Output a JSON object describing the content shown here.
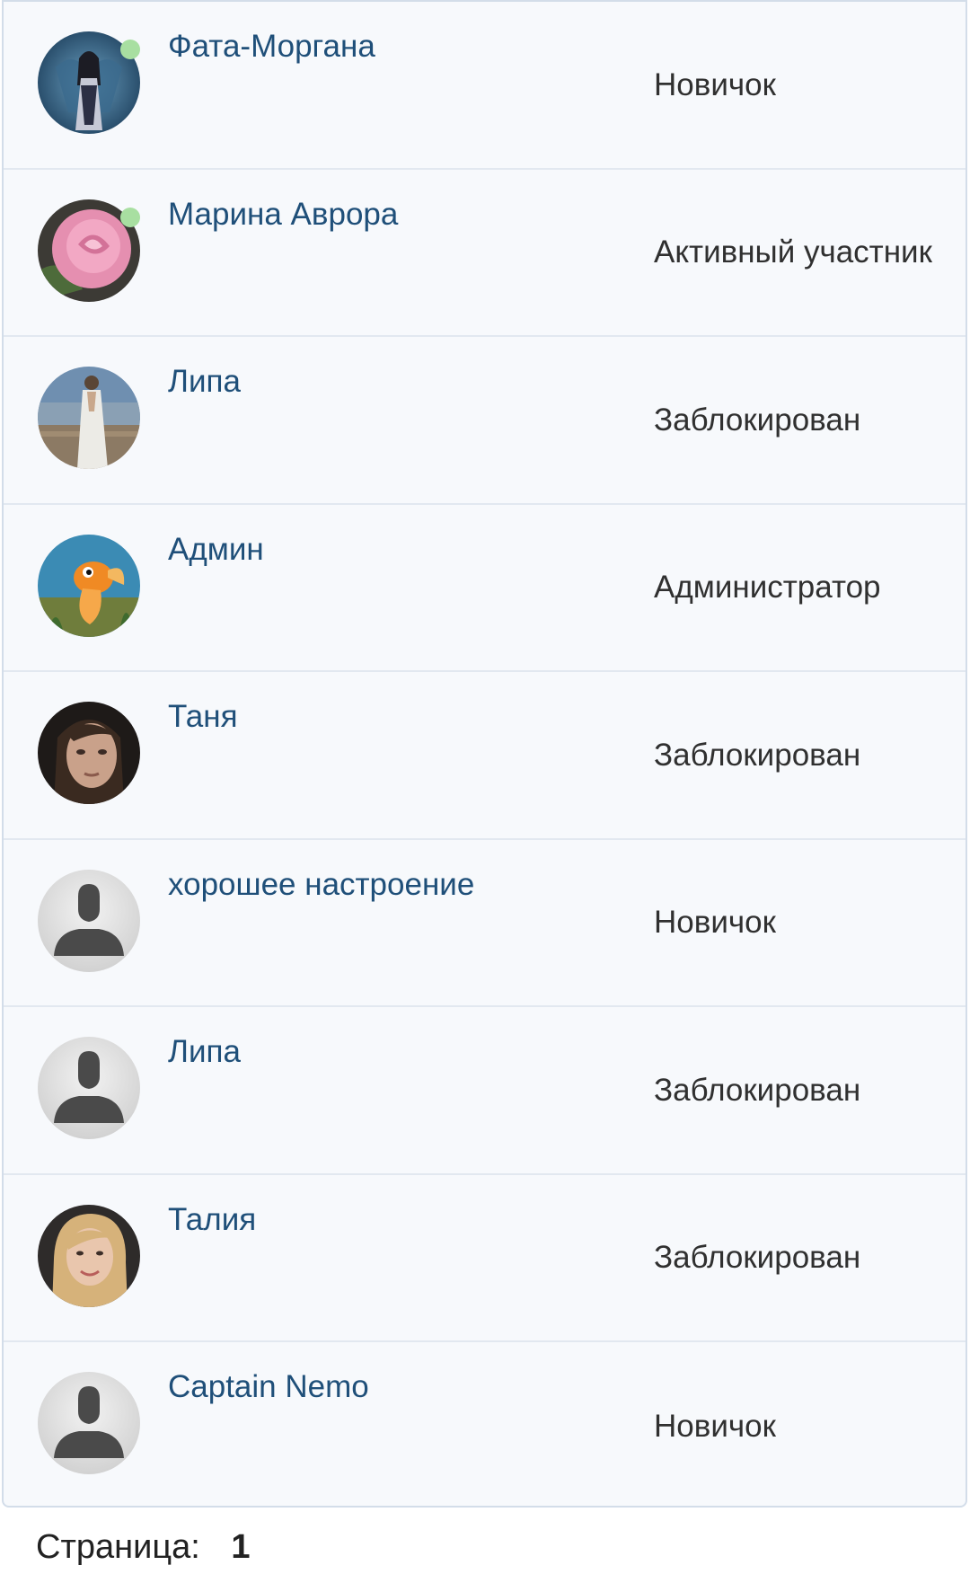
{
  "members": [
    {
      "name": "Фата-Моргана",
      "role": "Новичок",
      "online": true,
      "avatar": "photo-dark-fantasy-woman-icon"
    },
    {
      "name": "Марина Аврора",
      "role": "Активный участник",
      "online": true,
      "avatar": "photo-pink-rose-icon"
    },
    {
      "name": "Липа",
      "role": "Заблокирован",
      "online": false,
      "avatar": "photo-woman-white-dress-icon"
    },
    {
      "name": "Админ",
      "role": "Администратор",
      "online": false,
      "avatar": "photo-goldfish-cartoon-icon"
    },
    {
      "name": "Таня",
      "role": "Заблокирован",
      "online": false,
      "avatar": "photo-woman-portrait-icon"
    },
    {
      "name": "хорошее настроение",
      "role": "Новичок",
      "online": false,
      "avatar": "default-user-silhouette-icon"
    },
    {
      "name": "Липа",
      "role": "Заблокирован",
      "online": false,
      "avatar": "default-user-silhouette-icon"
    },
    {
      "name": "Талия",
      "role": "Заблокирован",
      "online": false,
      "avatar": "photo-blonde-woman-icon"
    },
    {
      "name": "Captain Nemo",
      "role": "Новичок",
      "online": false,
      "avatar": "default-user-silhouette-icon"
    }
  ],
  "pagination": {
    "label": "Страница:",
    "current": "1"
  },
  "colors": {
    "name_link": "#1f4f79",
    "online_dot": "#a8dfa1",
    "row_bg": "#f7f9fc",
    "border": "#d3dde9"
  }
}
